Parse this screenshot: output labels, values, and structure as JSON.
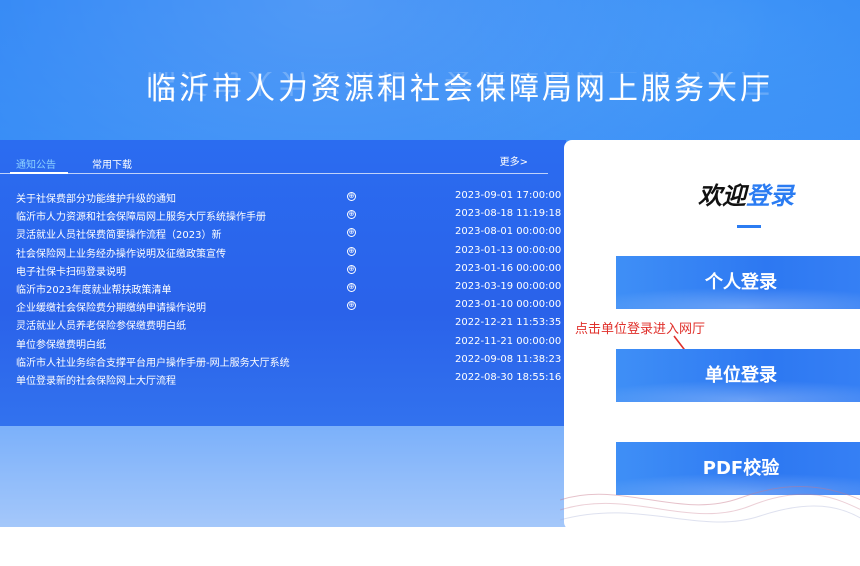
{
  "header": {
    "title": "临沂市人力资源和社会保障局网上服务大厅"
  },
  "notices": {
    "tabs": [
      {
        "label": "通知公告",
        "active": true
      },
      {
        "label": "常用下载",
        "active": false
      }
    ],
    "more_label": "更多>",
    "items": [
      {
        "title": "关于社保费部分功能维护升级的通知",
        "badge": true,
        "date": "2023-09-01 17:00:00"
      },
      {
        "title": "临沂市人力资源和社会保障局网上服务大厅系统操作手册",
        "badge": true,
        "date": "2023-08-18 11:19:18"
      },
      {
        "title": "灵活就业人员社保费简要操作流程（2023）新",
        "badge": true,
        "date": "2023-08-01 00:00:00"
      },
      {
        "title": "社会保险网上业务经办操作说明及征缴政策宣传",
        "badge": true,
        "date": "2023-01-13 00:00:00"
      },
      {
        "title": "电子社保卡扫码登录说明",
        "badge": true,
        "date": "2023-01-16 00:00:00"
      },
      {
        "title": "临沂市2023年度就业帮扶政策清单",
        "badge": true,
        "date": "2023-03-19 00:00:00"
      },
      {
        "title": "企业缓缴社会保险费分期缴纳申请操作说明",
        "badge": true,
        "date": "2023-01-10 00:00:00"
      },
      {
        "title": "灵活就业人员养老保险参保缴费明白纸",
        "badge": false,
        "date": "2022-12-21 11:53:35"
      },
      {
        "title": "单位参保缴费明白纸",
        "badge": false,
        "date": "2022-11-21 00:00:00"
      },
      {
        "title": "临沂市人社业务综合支撑平台用户操作手册-网上服务大厅系统",
        "badge": false,
        "date": "2022-09-08 11:38:23"
      },
      {
        "title": "单位登录新的社会保险网上大厅流程",
        "badge": false,
        "date": "2022-08-30 18:55:16"
      }
    ],
    "badge_glyph": "⊕"
  },
  "login": {
    "welcome_prefix": "欢迎",
    "welcome_accent": "登录",
    "personal_label": "个人登录",
    "unit_label": "单位登录",
    "pdf_label": "PDF校验"
  },
  "annotation": {
    "hint_text": "点击单位登录进入网厅",
    "color": "#e0302b"
  },
  "colors": {
    "accent": "#2b7cf2",
    "panel": "#2b6cf0",
    "tab_active": "#8fd3ff"
  }
}
